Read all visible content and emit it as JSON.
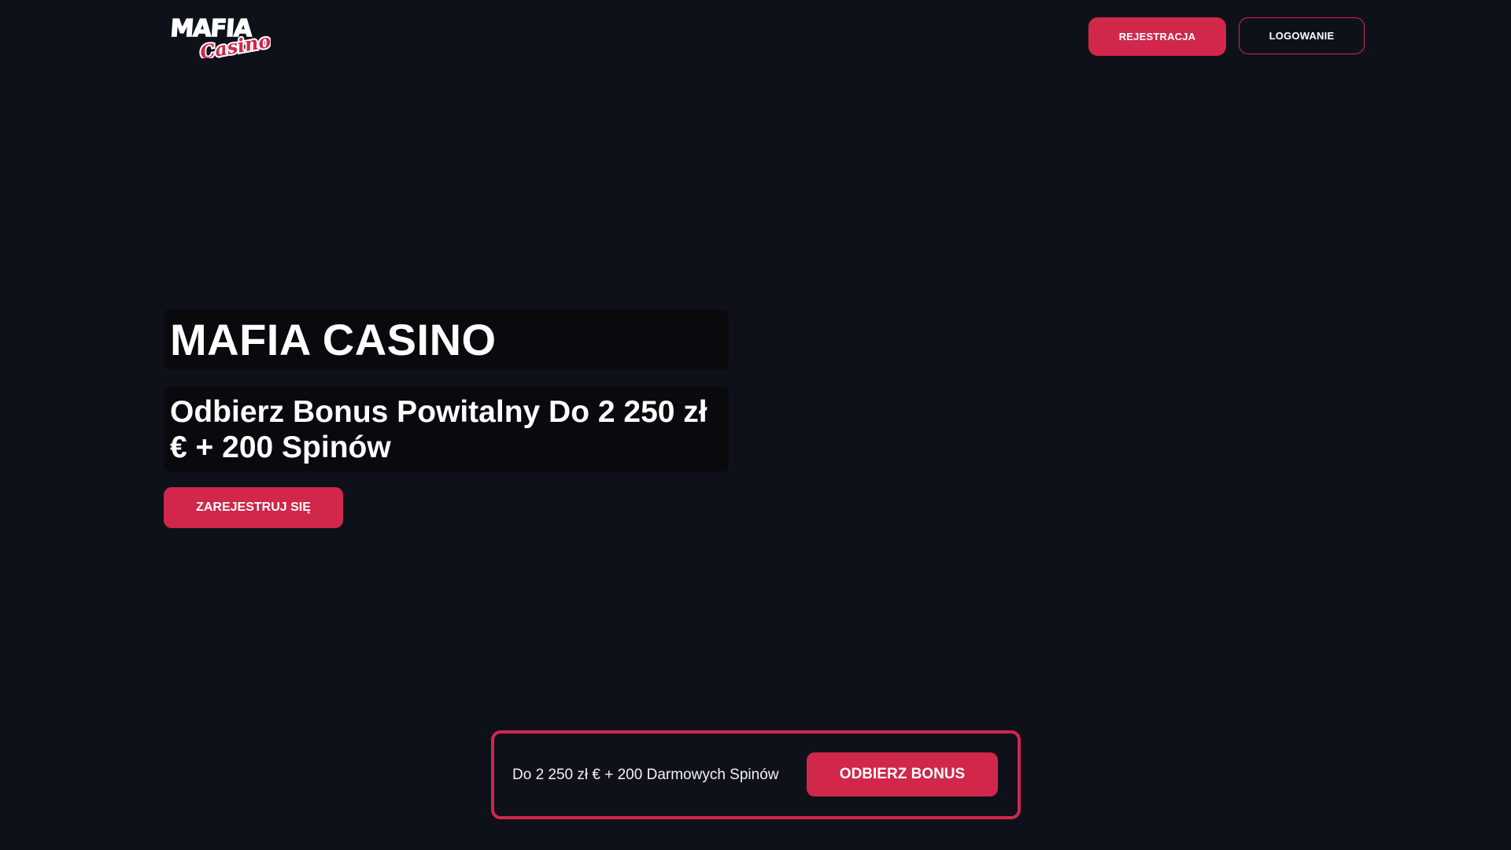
{
  "header": {
    "logo": {
      "word_top": "MAFIA",
      "word_bottom": "Casino"
    },
    "register_label": "REJESTRACJA",
    "login_label": "LOGOWANIE"
  },
  "hero": {
    "title": "MAFIA CASINO",
    "subtitle": "Odbierz Bonus Powitalny Do 2 250 zł € + 200 Spinów",
    "cta_label": "ZAREJESTRUJ SIĘ"
  },
  "bonus_bar": {
    "text": "Do 2 250 zł € + 200 Darmowych Spinów",
    "button_label": "ODBIERZ BONUS"
  },
  "colors": {
    "background": "#0f111a",
    "accent": "#d0274b",
    "panel": "#0a0a0e",
    "text": "#ffffff"
  }
}
